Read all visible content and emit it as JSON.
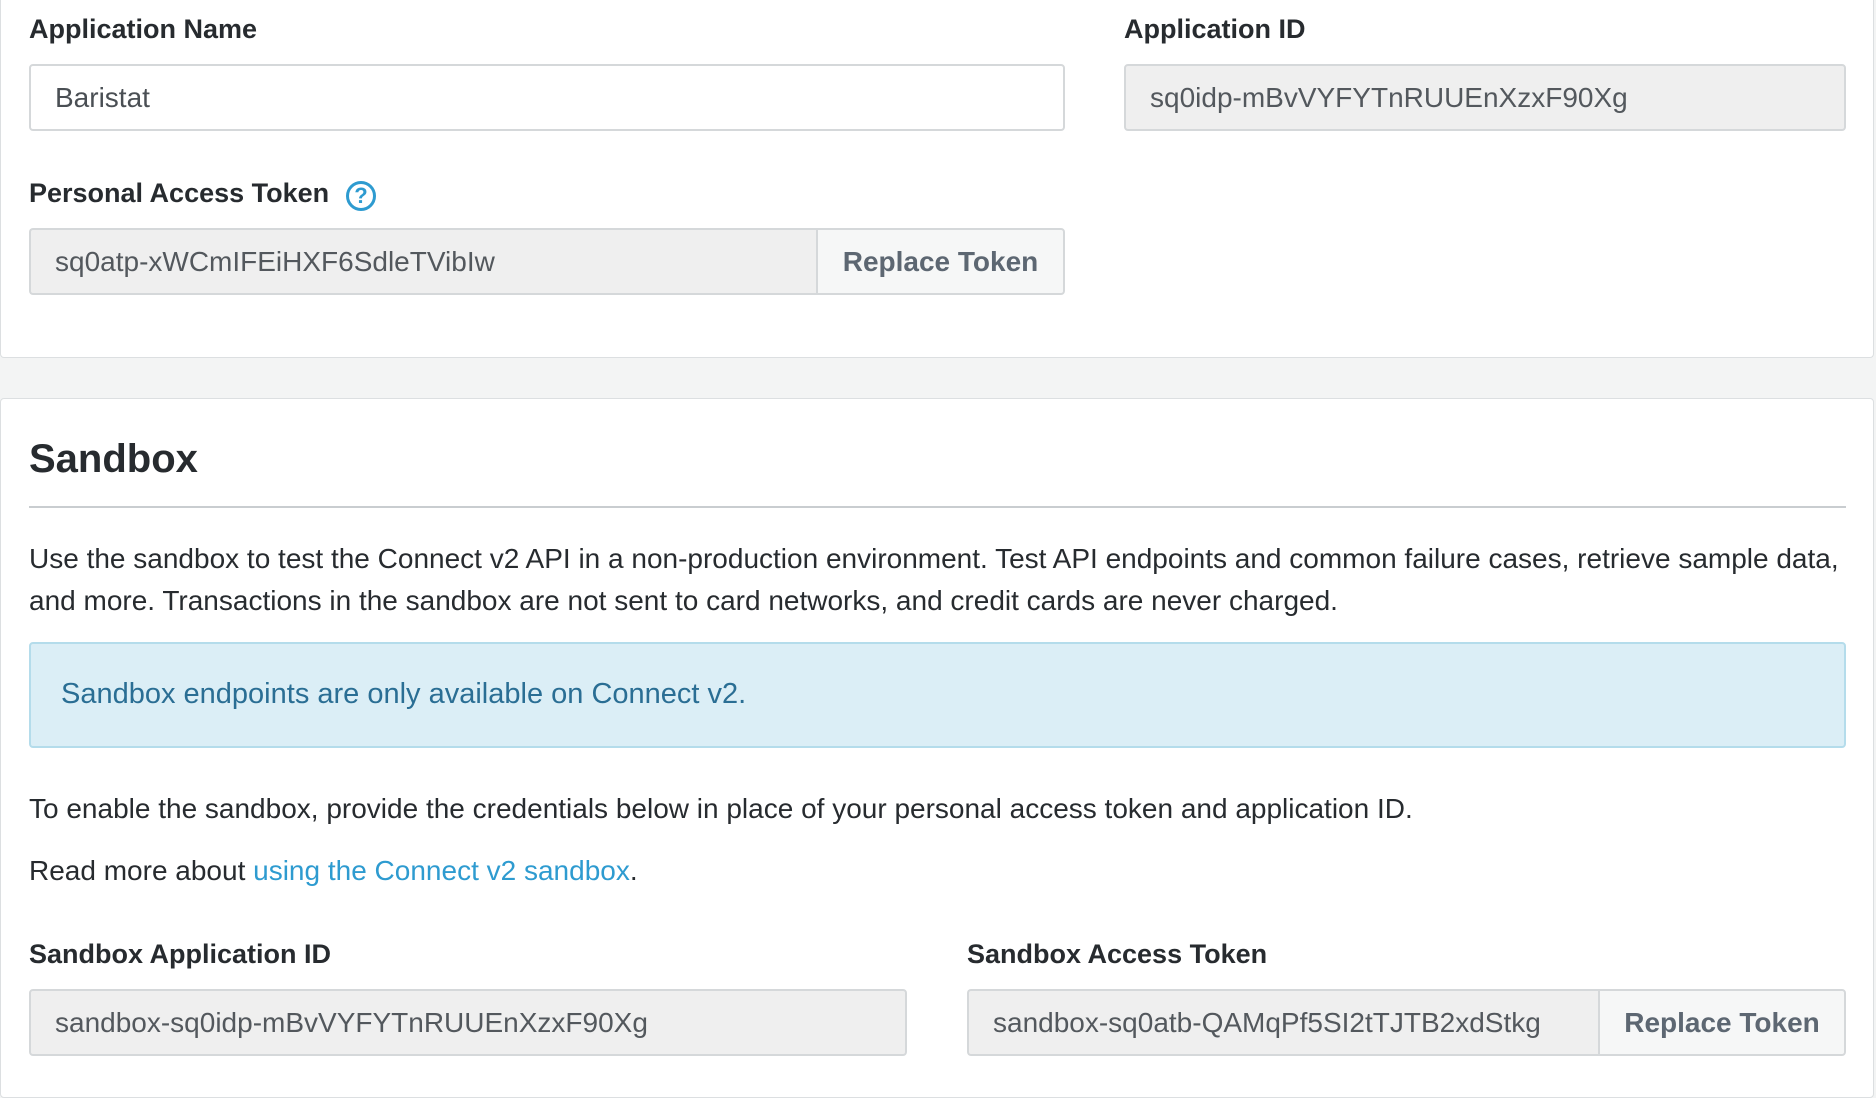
{
  "app_settings": {
    "application_name_label": "Application Name",
    "application_name_value": "Baristat",
    "application_id_label": "Application ID",
    "application_id_value": "sq0idp-mBvVYFYTnRUUEnXzxF90Xg",
    "personal_access_token_label": "Personal Access Token",
    "help_icon_glyph": "?",
    "personal_access_token_value": "sq0atp-xWCmIFEiHXF6SdleTVibIw",
    "replace_token_label": "Replace Token"
  },
  "sandbox": {
    "heading": "Sandbox",
    "description": "Use the sandbox to test the Connect v2 API in a non-production environment. Test API endpoints and common failure cases, retrieve sample data, and more. Transactions in the sandbox are not sent to card networks, and credit cards are never charged.",
    "notice": "Sandbox endpoints are only available on Connect v2.",
    "enable_text": "To enable the sandbox, provide the credentials below in place of your personal access token and application ID.",
    "read_more_prefix": "Read more about ",
    "read_more_link": "using the Connect v2 sandbox",
    "read_more_suffix": ".",
    "application_id_label": "Sandbox Application ID",
    "application_id_value": "sandbox-sq0idp-mBvVYFYTnRUUEnXzxF90Xg",
    "access_token_label": "Sandbox Access Token",
    "access_token_value": "sandbox-sq0atb-QAMqPf5SI2tTJTB2xdStkg",
    "replace_token_label": "Replace Token"
  },
  "colors": {
    "accent": "#2e9bd0",
    "notice_bg": "#dbeef6",
    "notice_text": "#2a6e94",
    "readonly_bg": "#efefef",
    "page_bg": "#f3f4f4"
  }
}
